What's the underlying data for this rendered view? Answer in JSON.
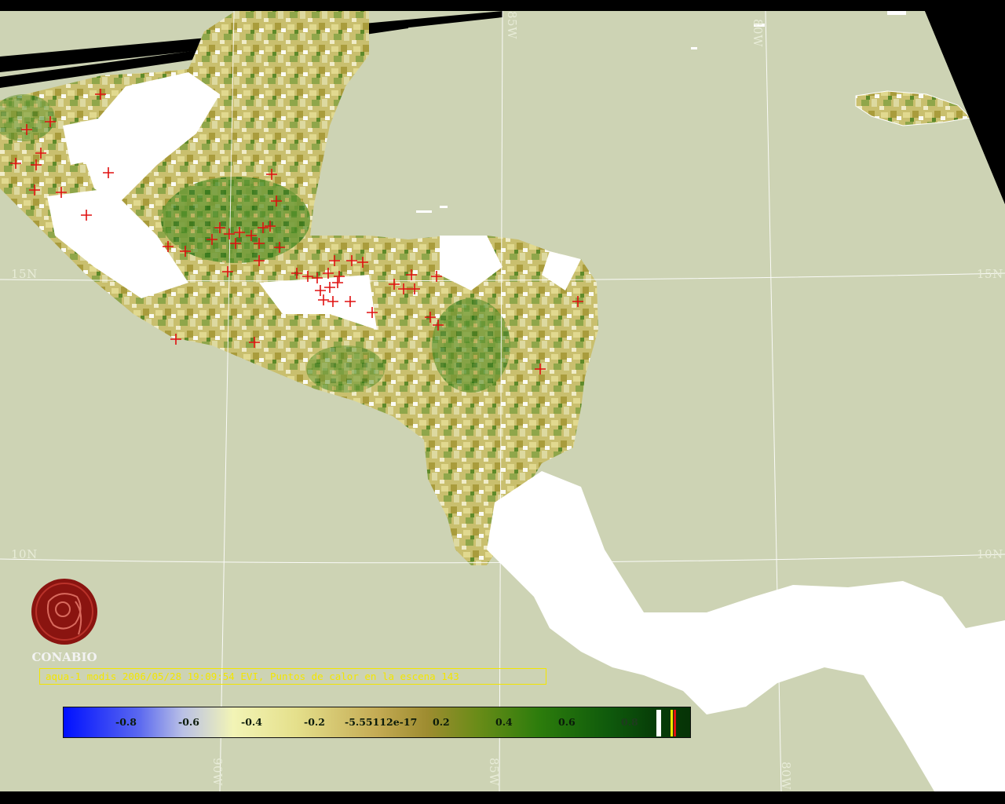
{
  "map": {
    "caption": "aqua-1 modis 2006/05/28 19:09:54 EVI, Puntos de calor en la escena 143",
    "logo_text": "CONABIO",
    "grid_labels": {
      "lat_15_left": "15N",
      "lat_15_right": "15N",
      "lat_10_left": "10N",
      "lat_10_right": "10N",
      "lon_85_top": "85W",
      "lon_80_top": "80W",
      "lon_90_bottom": "90W",
      "lon_85_bottom": "85W",
      "lon_80_bottom": "80W"
    },
    "colorbar_labels": [
      "-0.8",
      "-0.6",
      "-0.4",
      "-0.2",
      "-5.55112e-17",
      "0.2",
      "0.4",
      "0.6",
      "0.8"
    ],
    "colors": {
      "ocean": "#cdd3b4",
      "no_data_cloud": "#ffffff",
      "background": "#000000",
      "hotspot": "#e01010",
      "caption_text": "#f3e600",
      "grid": "#ffffff",
      "logo": "#8a1410"
    },
    "icons": [
      "hotspot-cross-icon",
      "conabio-logo-icon"
    ]
  }
}
